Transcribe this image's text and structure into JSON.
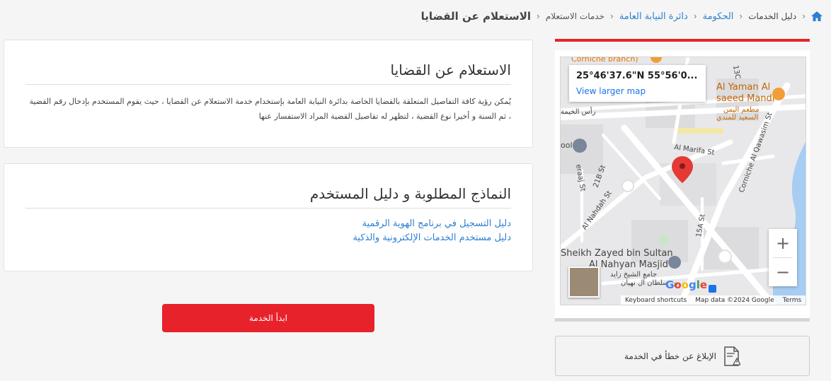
{
  "breadcrumb": {
    "items": [
      "دليل الخدمات",
      "الحكومة",
      "دائرة النيابة العامة",
      "خدمات الاستعلام"
    ],
    "current": "الاستعلام عن القضايا"
  },
  "intro_card": {
    "title": "الاستعلام عن القضايا",
    "text": "يُمكن رؤية كافة التفاصيل المتعلقة بالقضايا الخاصة بدائرة النيابة العامة بإستخدام خدمة الاستعلام عن القضايا ، حيث يقوم المستخدم بإدخال رقم القضية ، ثم السنة و أخيرا نوع القضية ، لتظهر له تفاصيل القضية المراد الاستفسار عنها"
  },
  "forms_card": {
    "title": "النماذج المطلوبة و دليل المستخدم",
    "links": [
      "دليل التسجيل في برنامج الهوية الرقمية",
      "دليل مستخدم الخدمات الإلكترونية والذكية"
    ]
  },
  "start_button": "ابدأ الخدمة",
  "map": {
    "coords": "25°46'37.6\"N 55°56'0...",
    "larger_link": "View larger map",
    "labels": {
      "corniche_branch": "Corniche branch)",
      "yaman": "Al Yaman Al",
      "saeed": "saeed Mandi",
      "yaman_ar": "مطعم اليمن",
      "saeed_ar": "السعيد للمندي",
      "marifa": "Al Marifa St",
      "qawasim": "Corniche Al Qawasim St",
      "nahdah": "Al Nahdah St",
      "b21": "21B St",
      "a15": "15A St",
      "sheikh": "Sheikh Zayed bin Sultan",
      "nahyan": "Al Nahyan Masjid",
      "masjid_ar": "جامع الشيخ زايد",
      "masjid_ar2": "بن سلطان آل نهيان",
      "kh": "رأس الخيمة",
      "n13c": "13C",
      "st": "St",
      "raaj": "eraaj St",
      "ool": "ool"
    },
    "footer": [
      "Keyboard shortcuts",
      "Map data ©2024 Google",
      "Terms"
    ],
    "zoom_in": "+",
    "zoom_out": "−",
    "google": [
      "G",
      "o",
      "o",
      "g",
      "l",
      "e"
    ]
  },
  "report_button": "الإبلاغ عن خطأ في الخدمة",
  "colors": {
    "accent": "#e8222b",
    "link": "#2d7fd3"
  }
}
